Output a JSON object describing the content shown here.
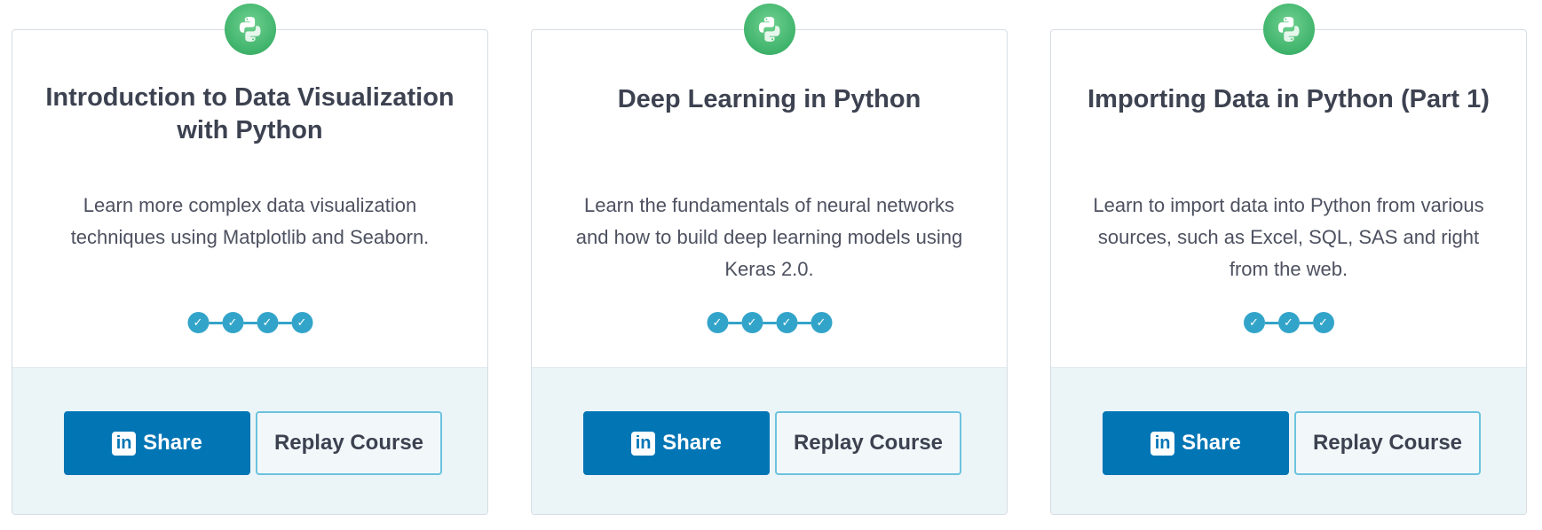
{
  "cards": [
    {
      "title": "Introduction to Data Visualization with Python",
      "description": "Learn more complex data visualization techniques using Matplotlib and Seaborn.",
      "chapters_completed": 4,
      "share_label": "Share",
      "replay_label": "Replay Course",
      "badge_icon": "python-icon"
    },
    {
      "title": "Deep Learning in Python",
      "description": "Learn the fundamentals of neural networks and how to build deep learning models using Keras 2.0.",
      "chapters_completed": 4,
      "share_label": "Share",
      "replay_label": "Replay Course",
      "badge_icon": "python-icon"
    },
    {
      "title": "Importing Data in Python (Part 1)",
      "description": "Learn to import data into Python from various sources, such as Excel, SQL, SAS and right from the web.",
      "chapters_completed": 3,
      "share_label": "Share",
      "replay_label": "Replay Course",
      "badge_icon": "python-icon"
    }
  ],
  "icons": {
    "share_logo": "in",
    "check": "✓"
  },
  "colors": {
    "badge_green": "#3fb36b",
    "progress_blue": "#33a4c9",
    "share_blue": "#0275b5",
    "replay_border": "#6cc3de",
    "footer_bg": "#ebf4f7"
  }
}
